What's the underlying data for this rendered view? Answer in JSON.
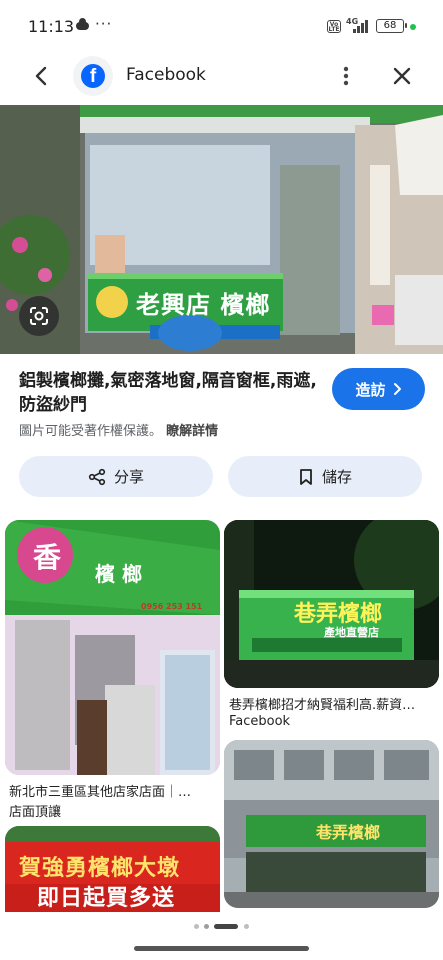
{
  "status": {
    "time": "11:13",
    "overflow": "···",
    "volte": "VoLTE",
    "network": "4G",
    "battery": "68"
  },
  "topbar": {
    "title": "Facebook",
    "logo_letter": "f"
  },
  "result": {
    "title": "鋁製檳榔攤,氣密落地窗,隔音窗框,雨遮,防盜紗門",
    "visit_label": "造訪",
    "copyright_text": "圖片可能受著作權保護。",
    "learn_more": "瞭解詳情"
  },
  "actions": {
    "share_label": "分享",
    "save_label": "儲存"
  },
  "hero_sign": {
    "text": "老興店 檳榔"
  },
  "cards": [
    {
      "sign": "香",
      "sign2": "檳 榔",
      "phone": "0956 253 151",
      "caption": "新北市三重區其他店家店面｜…",
      "source": "店面頂讓"
    },
    {
      "sign": "巷弄檳榔",
      "sub": "產地直營店",
      "caption": "巷弄檳榔招才納賢福利高.薪資…",
      "source": "Facebook"
    },
    {
      "sign": "賀強勇檳榔大墩",
      "sub": "即日起買多送"
    },
    {
      "sign": "巷弄檳榔"
    }
  ],
  "colors": {
    "accent": "#1a73e8",
    "pill_bg": "#e8eef9",
    "sign_green": "#2ea043"
  }
}
